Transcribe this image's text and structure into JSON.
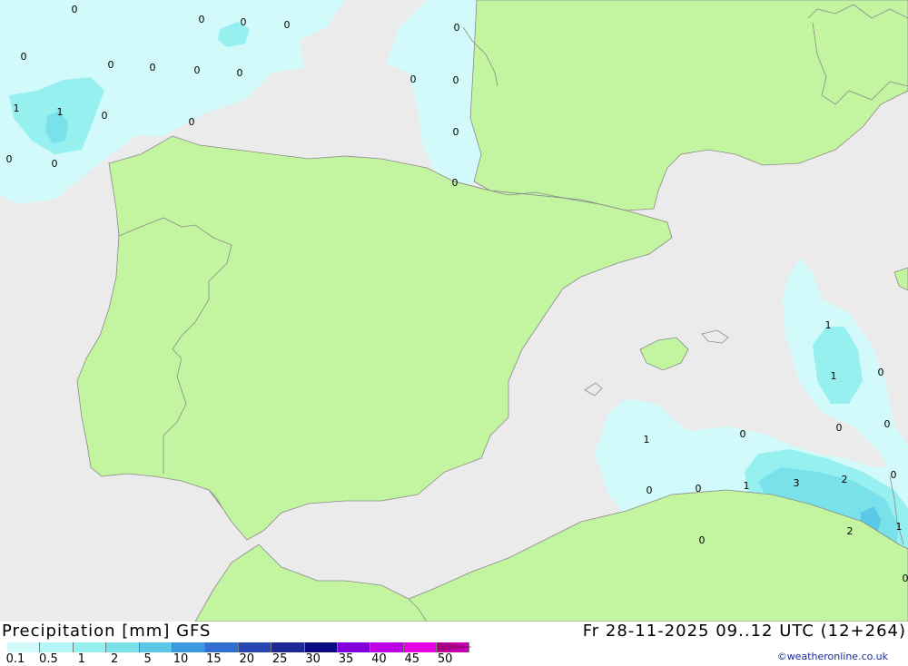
{
  "footer": {
    "title": "Precipitation [mm] GFS",
    "date": "Fr 28-11-2025 09..12 UTC (12+264)",
    "credit": "©weatheronline.co.uk"
  },
  "legend": {
    "levels": [
      "0.1",
      "0.5",
      "1",
      "2",
      "5",
      "10",
      "15",
      "20",
      "25",
      "30",
      "35",
      "40",
      "45",
      "50"
    ],
    "colors": [
      "#d3fafa",
      "#b4f6f6",
      "#96f0f0",
      "#78e1ea",
      "#5ac8e6",
      "#3c9ae0",
      "#326ed2",
      "#2846b4",
      "#1e2896",
      "#0a0a82",
      "#8200dc",
      "#be00e6",
      "#e600e6",
      "#c800b4"
    ],
    "arrow_color": "#a5007f"
  },
  "map": {
    "colors": {
      "sea": "#ebebeb",
      "land": "#c3f5a0",
      "border": "#8a8a8a",
      "precip_light": "#d3fafa",
      "precip_mid": "#96f0f0",
      "precip_high": "#78e1ea",
      "precip_peak": "#5ac8e6"
    },
    "value_labels": [
      "0",
      "0",
      "0",
      "0",
      "0",
      "0",
      "0",
      "0",
      "0",
      "0",
      "1",
      "1",
      "0",
      "0",
      "0",
      "0",
      "0",
      "0",
      "0",
      "0",
      "1",
      "1",
      "0",
      "0",
      "0",
      "1",
      "0",
      "0",
      "0",
      "1",
      "3",
      "2",
      "0",
      "2",
      "1",
      "0",
      "0"
    ]
  }
}
